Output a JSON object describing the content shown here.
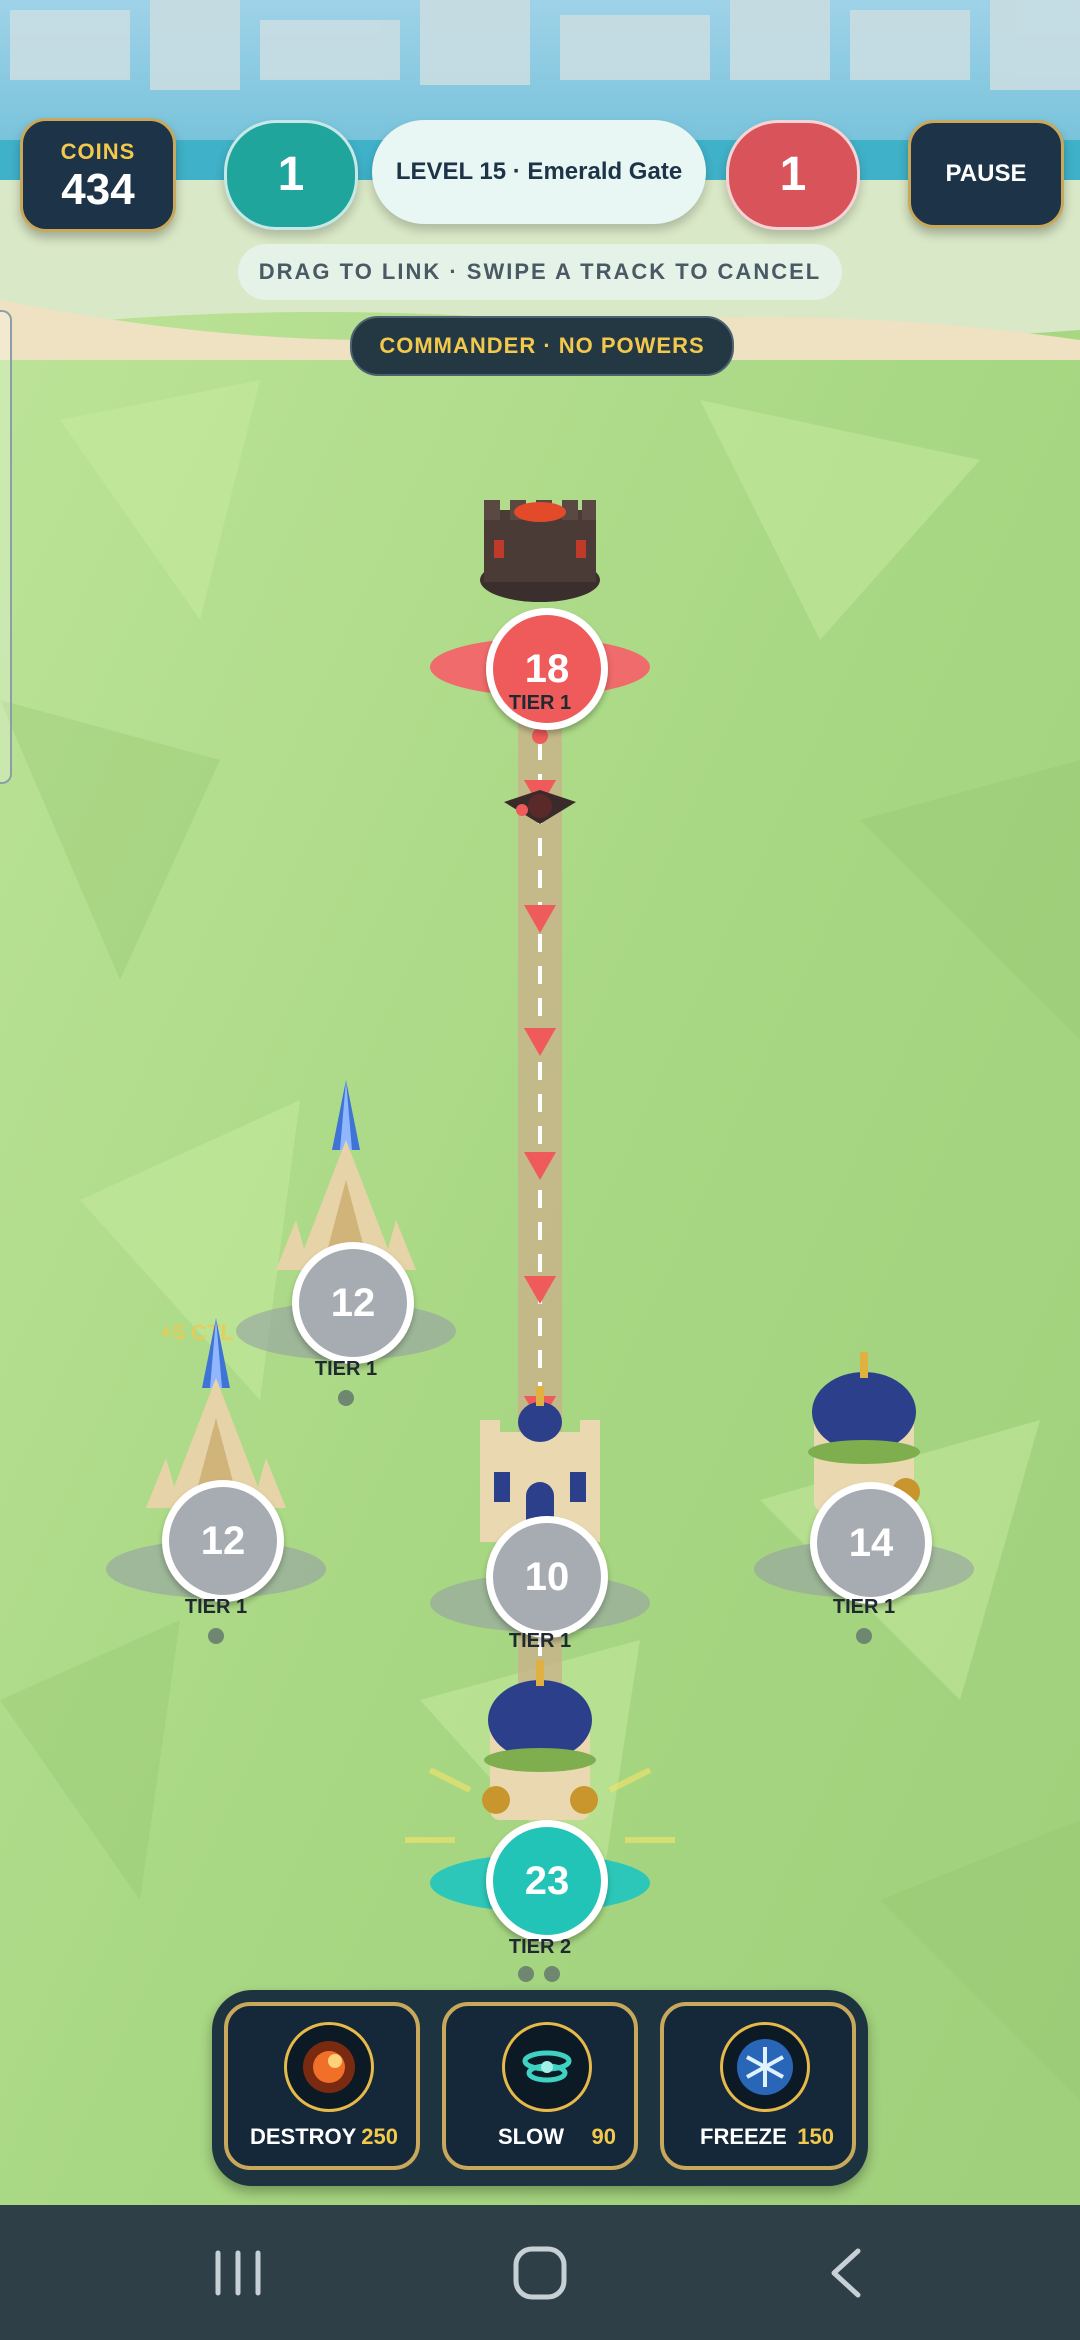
{
  "hud": {
    "coins_label": "COINS",
    "coins_value": "434",
    "player_score": "1",
    "level_title": "LEVEL 15 · Emerald Gate",
    "enemy_score": "1",
    "pause_label": "PAUSE",
    "hint": "DRAG TO LINK · SWIPE A TRACK TO CANCEL",
    "commander": "COMMANDER · NO POWERS"
  },
  "towers": [
    {
      "owner": "enemy",
      "units": "18",
      "tier": "TIER 1"
    },
    {
      "owner": "neutral",
      "units": "12",
      "tier": "TIER 1"
    },
    {
      "owner": "neutral",
      "units": "12",
      "tier": "TIER 1",
      "floating_text": "+5 CTL"
    },
    {
      "owner": "neutral",
      "units": "10",
      "tier": "TIER 1"
    },
    {
      "owner": "neutral",
      "units": "14",
      "tier": "TIER 1"
    },
    {
      "owner": "player",
      "units": "23",
      "tier": "TIER 2"
    }
  ],
  "powers": [
    {
      "name": "DESTROY",
      "cost": "250",
      "icon": "fire-meteor-icon"
    },
    {
      "name": "SLOW",
      "cost": "90",
      "icon": "vortex-icon"
    },
    {
      "name": "FREEZE",
      "cost": "150",
      "icon": "snowflake-icon"
    }
  ],
  "nav": {
    "recents": "recents-icon",
    "home": "home-icon",
    "back": "back-icon"
  },
  "colors": {
    "player": "#22c4b7",
    "enemy": "#ef5a5a",
    "neutral": "#a7acb3",
    "accent_gold": "#f2c94c",
    "panel_dark": "#1d3448"
  }
}
